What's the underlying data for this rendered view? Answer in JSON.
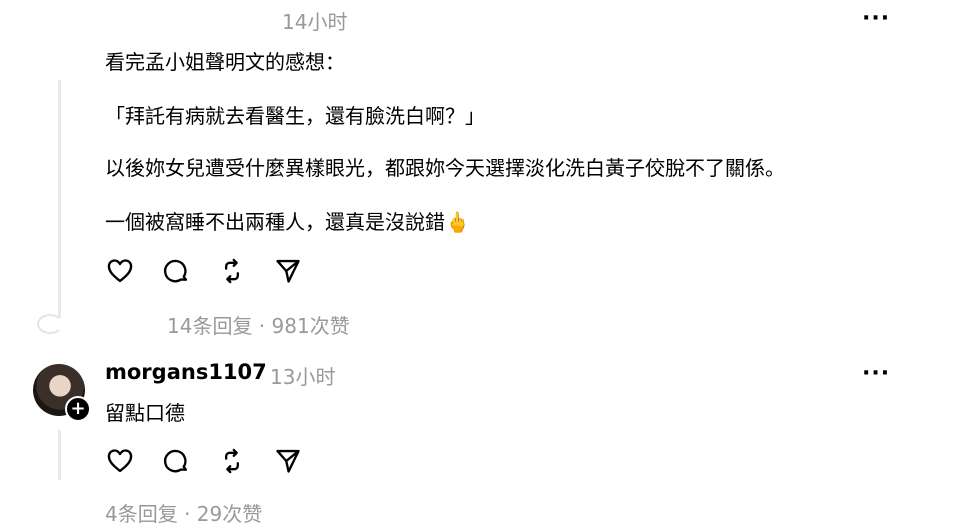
{
  "comment1": {
    "time": "14小时",
    "paragraphs": [
      "看完孟小姐聲明文的感想：",
      "「拜託有病就去看醫生，還有臉洗白啊？」",
      "以後妳女兒遭受什麼異樣眼光，都跟妳今天選擇淡化洗白黃子佼脫不了關係。",
      "一個被窩睡不出兩種人，還真是沒說錯🖕"
    ],
    "stats": "14条回复 · 981次赞"
  },
  "comment2": {
    "username": "morgans1107",
    "time": "13小时",
    "text": "留點口德",
    "stats": "4条回复 · 29次赞"
  },
  "more_label": "···",
  "icons": [
    "heart-icon",
    "comment-icon",
    "repost-icon",
    "share-icon"
  ]
}
